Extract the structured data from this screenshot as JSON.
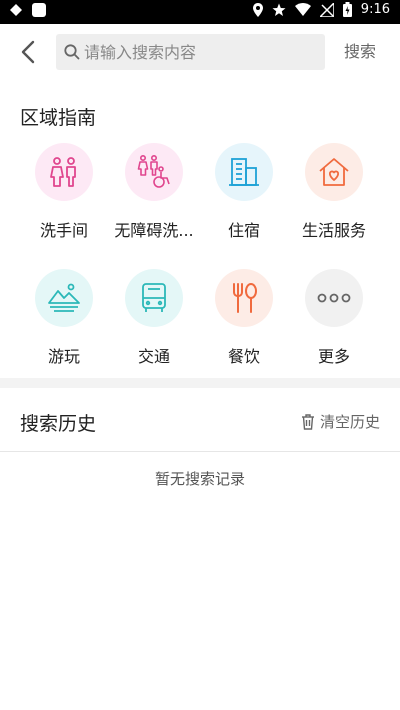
{
  "status_bar": {
    "time": "9:16"
  },
  "search": {
    "placeholder": "请输入搜索内容",
    "value": "",
    "button_label": "搜索"
  },
  "guide": {
    "title": "区域指南",
    "items": [
      {
        "label": "洗手间",
        "icon": "restroom-icon",
        "bg": "#fde9f5",
        "color": "#e0468e"
      },
      {
        "label": "无障碍洗...",
        "icon": "accessible-restroom-icon",
        "bg": "#fde9f5",
        "color": "#e0468e"
      },
      {
        "label": "住宿",
        "icon": "building-icon",
        "bg": "#e6f5fb",
        "color": "#1ea2d6"
      },
      {
        "label": "生活服务",
        "icon": "home-heart-icon",
        "bg": "#fdece6",
        "color": "#f06a3e"
      },
      {
        "label": "游玩",
        "icon": "mountain-icon",
        "bg": "#e4f7f7",
        "color": "#2bb8b8"
      },
      {
        "label": "交通",
        "icon": "bus-icon",
        "bg": "#e4f7f7",
        "color": "#2bb8b8"
      },
      {
        "label": "餐饮",
        "icon": "utensils-icon",
        "bg": "#fdece6",
        "color": "#f06a3e"
      },
      {
        "label": "更多",
        "icon": "more-icon",
        "bg": "#f1f1f1",
        "color": "#666666"
      }
    ]
  },
  "history": {
    "title": "搜索历史",
    "clear_label": "清空历史",
    "empty_text": "暂无搜索记录"
  }
}
